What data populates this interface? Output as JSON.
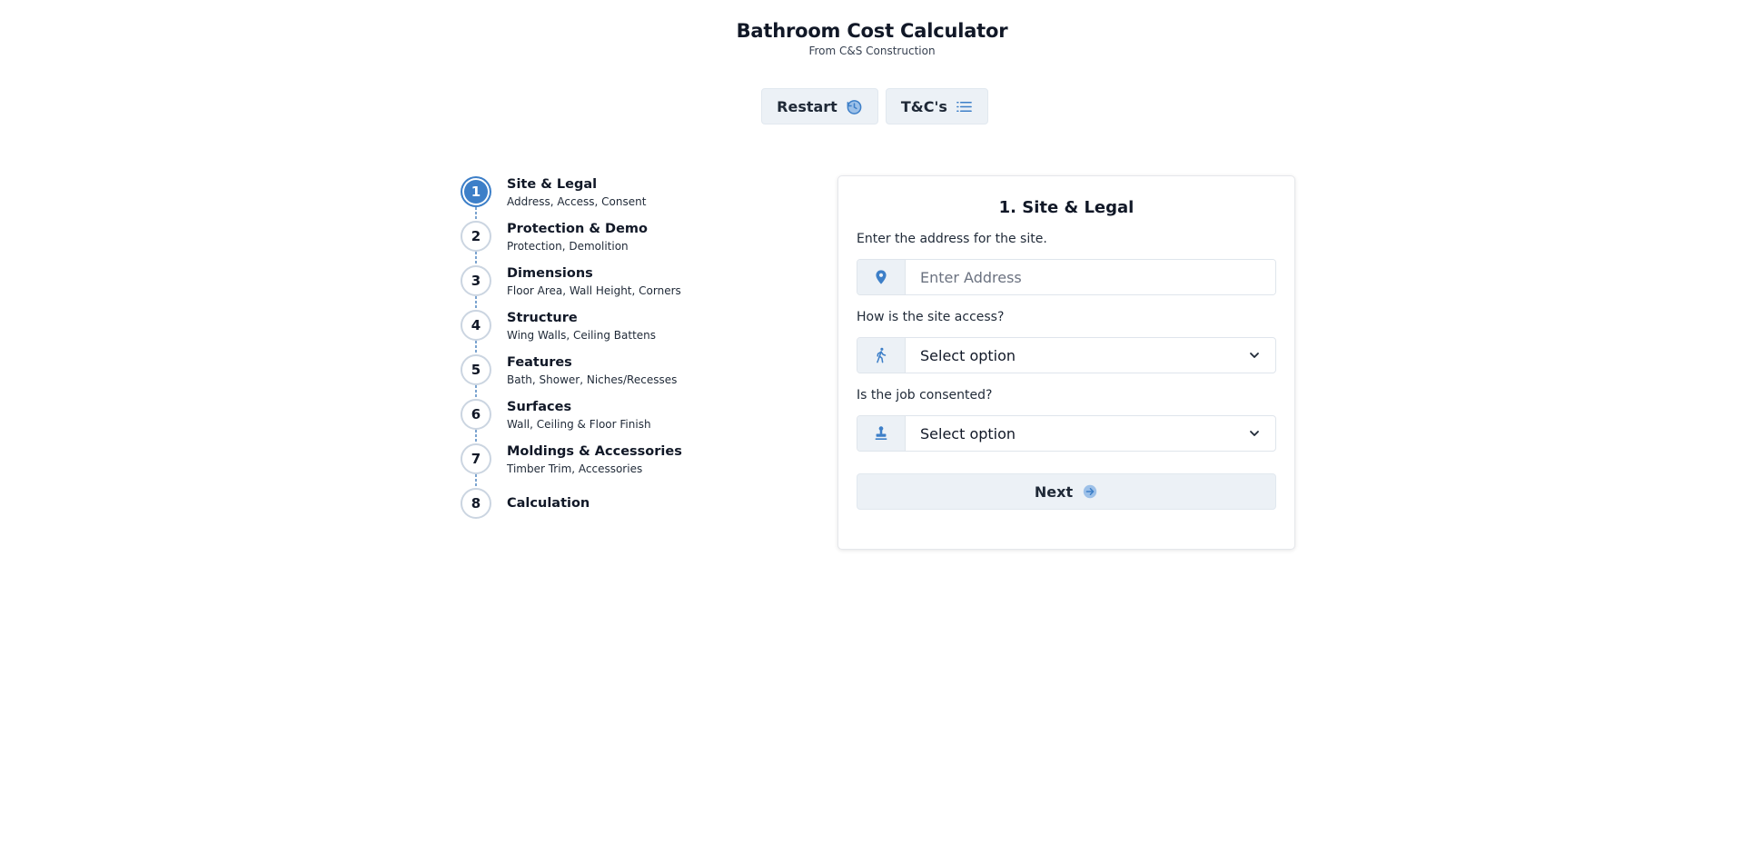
{
  "header": {
    "title": "Bathroom Cost Calculator",
    "subtitle": "From C&S Construction"
  },
  "actions": {
    "restart_label": "Restart",
    "terms_label": "T&C's"
  },
  "steps": [
    {
      "number": "1",
      "title": "Site & Legal",
      "desc": "Address, Access, Consent",
      "active": true
    },
    {
      "number": "2",
      "title": "Protection & Demo",
      "desc": "Protection, Demolition"
    },
    {
      "number": "3",
      "title": "Dimensions",
      "desc": "Floor Area, Wall Height, Corners"
    },
    {
      "number": "4",
      "title": "Structure",
      "desc": "Wing Walls, Ceiling Battens"
    },
    {
      "number": "5",
      "title": "Features",
      "desc": "Bath, Shower, Niches/Recesses"
    },
    {
      "number": "6",
      "title": "Surfaces",
      "desc": "Wall, Ceiling & Floor Finish"
    },
    {
      "number": "7",
      "title": "Moldings & Accessories",
      "desc": "Timber Trim, Accessories"
    },
    {
      "number": "8",
      "title": "Calculation"
    }
  ],
  "form": {
    "heading": "1. Site & Legal",
    "address_label": "Enter the address for the site.",
    "address_placeholder": "Enter Address",
    "address_value": "",
    "access_label": "How is the site access?",
    "access_value": "Select option",
    "consent_label": "Is the job consented?",
    "consent_value": "Select option",
    "next_label": "Next"
  },
  "colors": {
    "accent": "#3d7fc8",
    "button_bg": "#ecf1f6"
  }
}
